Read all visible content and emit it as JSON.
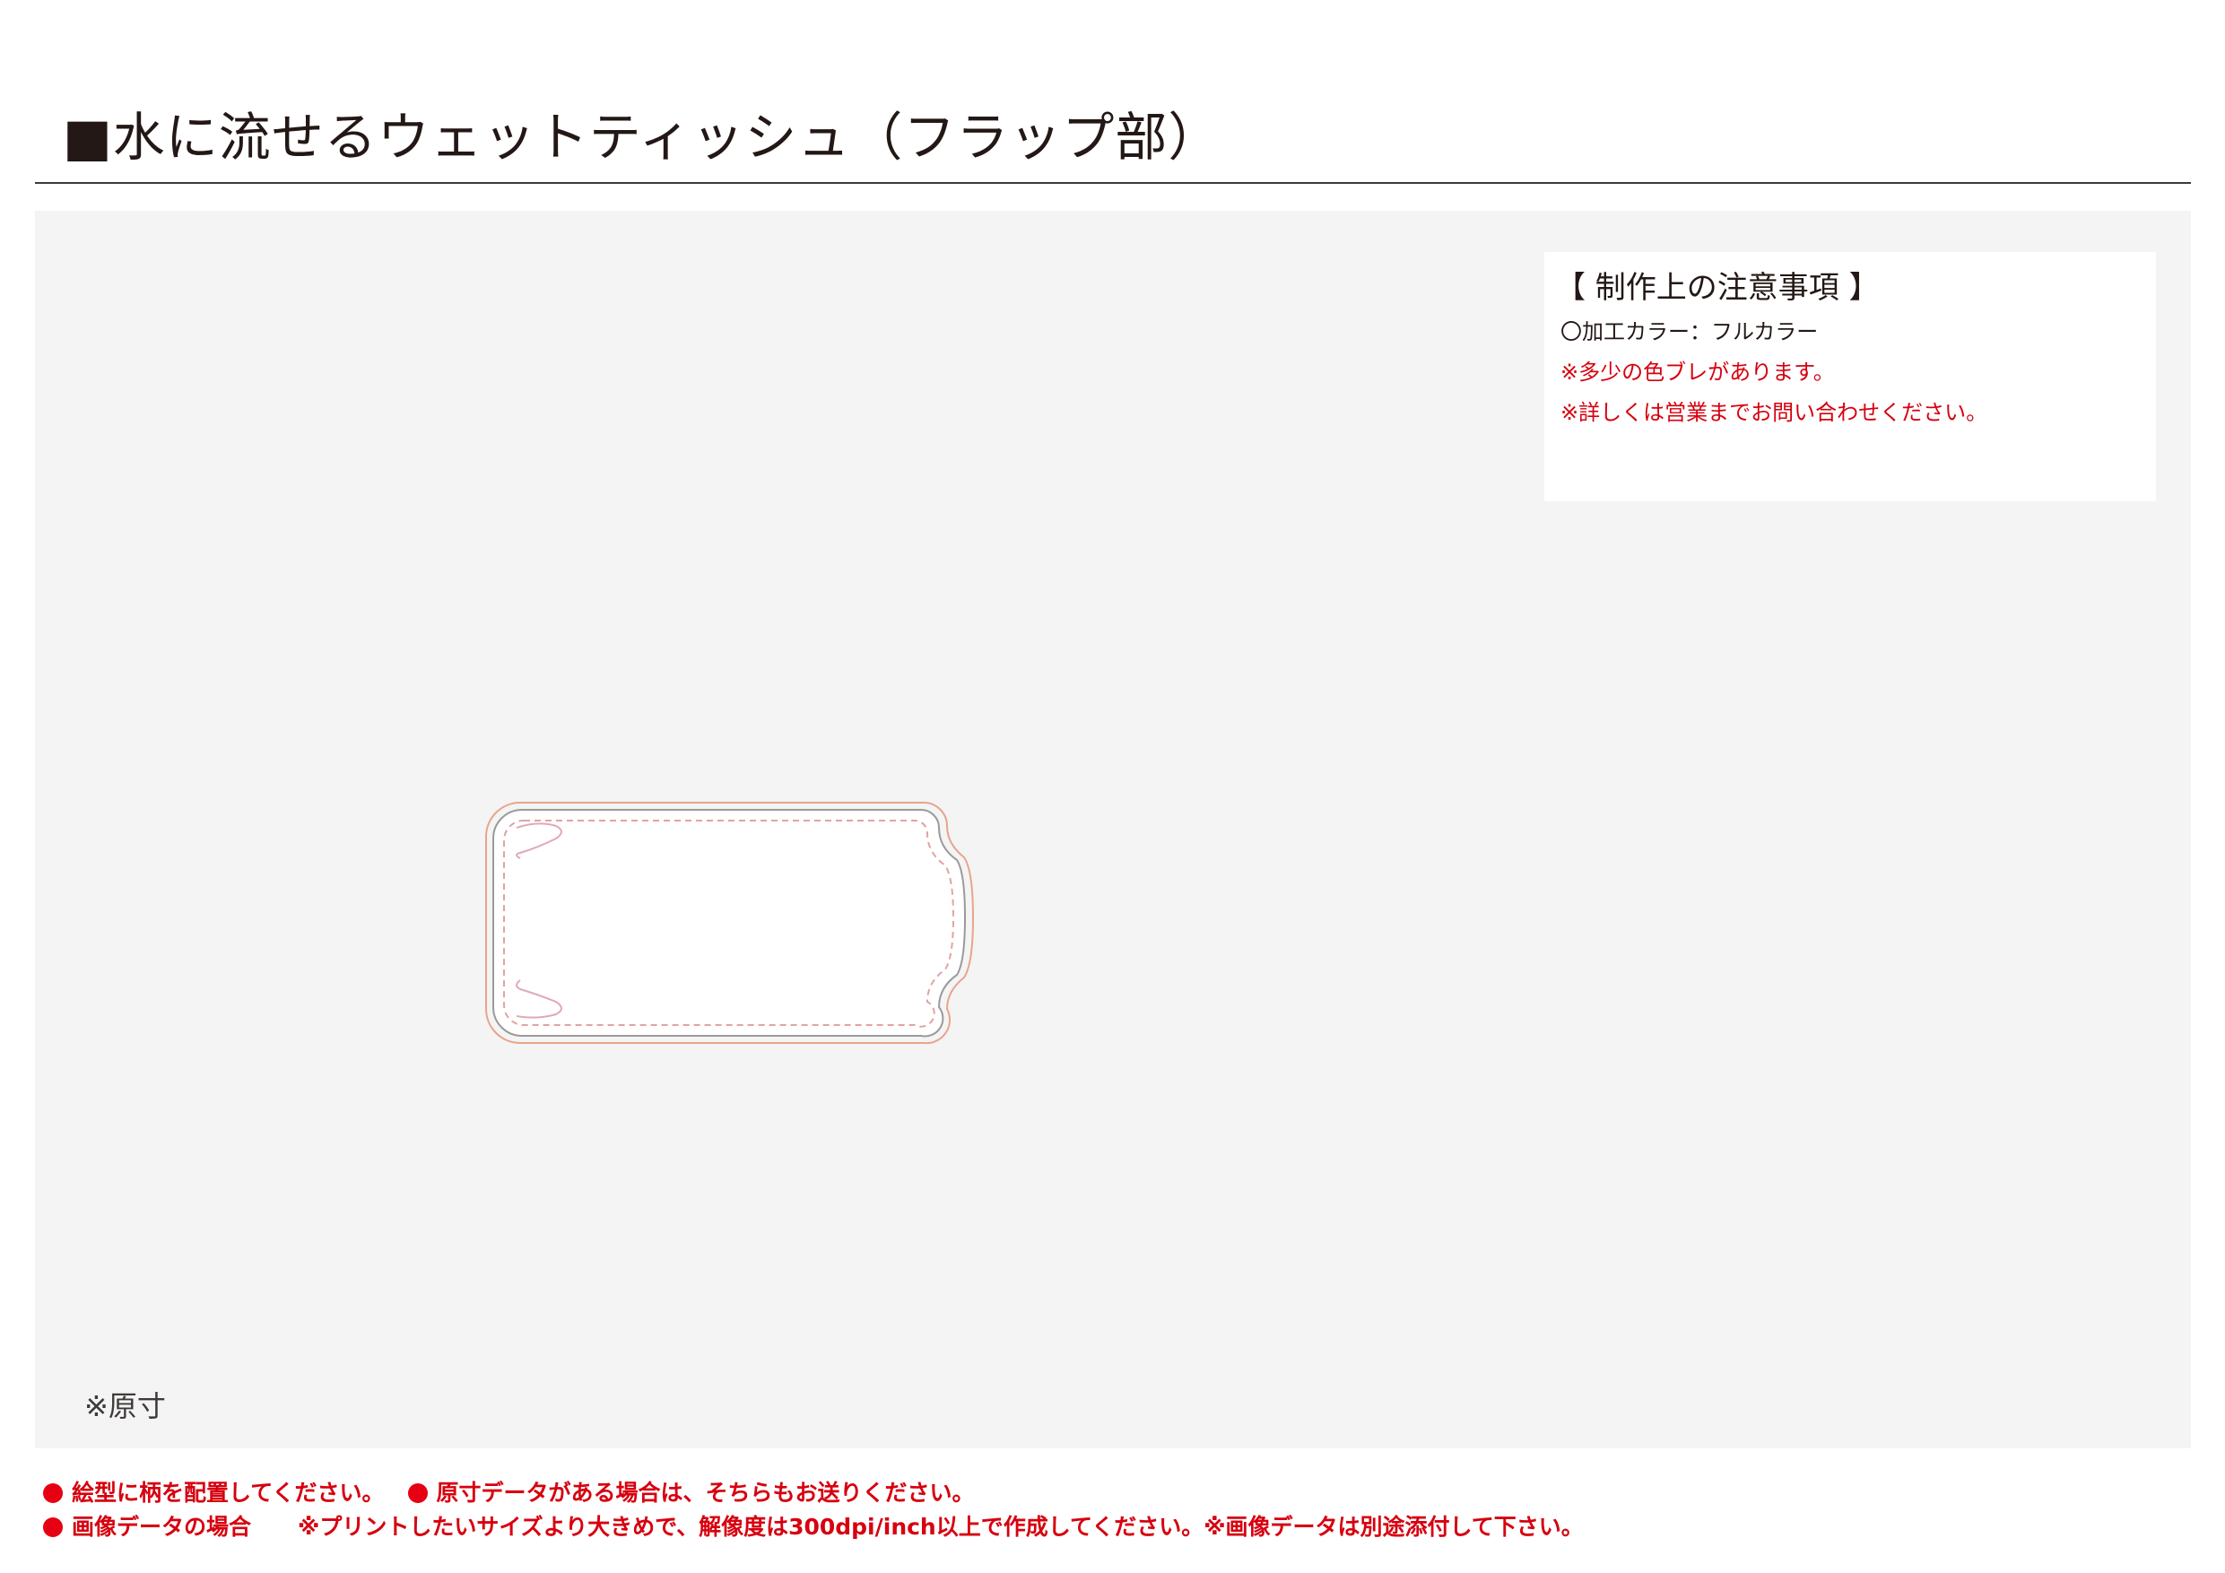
{
  "page": {
    "title": "■水に流せるウェットティッシュ（フラップ部）"
  },
  "notes": {
    "title": "【 制作上の注意事項 】",
    "lines": [
      "〇加工カラー：フルカラー",
      "※多少の色ブレがあります。",
      "※詳しくは営業までお問い合わせください。"
    ]
  },
  "scale_note": "※原寸",
  "footer": {
    "line1_a": "絵型に柄を配置してください。",
    "line1_b": "原寸データがある場合は、そちらもお送りください。",
    "line2_a": "画像データの場合",
    "line2_b": "※プリントしたいサイズより大きめで、解像度は300dpi/inch以上で作成してください。※画像データは別途添付して下さい。"
  },
  "colors": {
    "text": "#231815",
    "accent_red": "#d7000f",
    "canvas_bg": "#f4f4f4",
    "die_cut_outer": "#e8a48c",
    "die_cut_inner": "#9a9a9a",
    "safe_line": "#e2a3a3"
  }
}
